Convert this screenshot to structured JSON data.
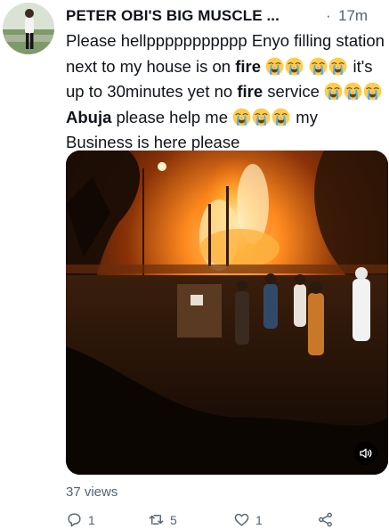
{
  "tweet": {
    "author_display_name": "PETER OBI'S BIG MUSCLE ...",
    "separator": "·",
    "timestamp": "17m",
    "text": {
      "s1": "Please hellppppppppppp Enyo filling station next to my house is on ",
      "fire1": "fire",
      "s2": " it's up to 30minutes yet no ",
      "fire2": "fire",
      "s3": " service ",
      "abuja": "Abuja",
      "s4": " please help me ",
      "s5": " my Business is here please"
    },
    "emoji_name": "loudly-crying-face",
    "views": "37 views"
  },
  "actions": {
    "reply_count": "1",
    "retweet_count": "5",
    "like_count": "1"
  },
  "icons": {
    "reply": "reply-icon",
    "retweet": "retweet-icon",
    "like": "heart-icon",
    "share": "share-icon",
    "sound": "speaker-icon"
  },
  "colors": {
    "text_primary": "#0f1419",
    "text_secondary": "#536471",
    "fire_orange": "#ff8a1f"
  }
}
